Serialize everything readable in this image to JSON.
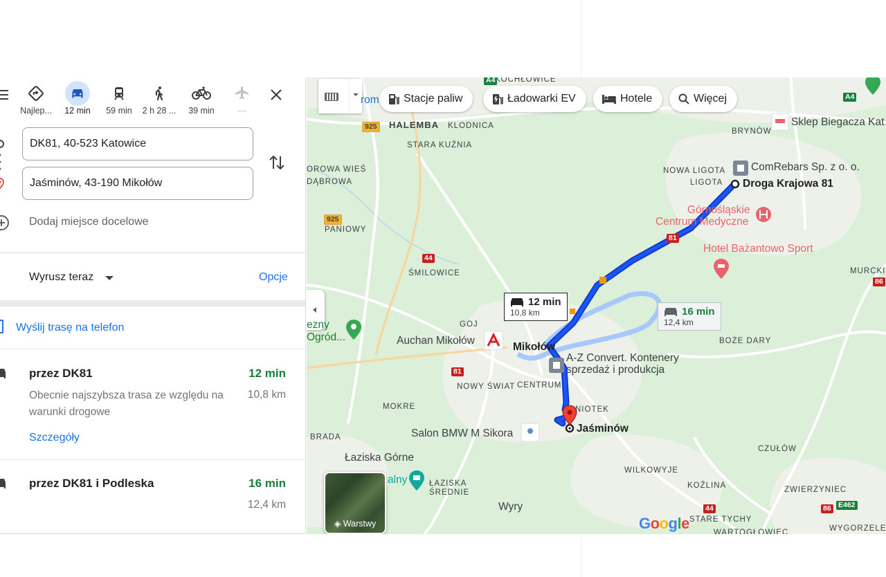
{
  "travel_modes": [
    {
      "id": "best",
      "label": "Najlep...",
      "icon": "directions-diamond-icon"
    },
    {
      "id": "car",
      "label": "12 min",
      "icon": "car-icon",
      "active": true
    },
    {
      "id": "transit",
      "label": "59 min",
      "icon": "train-icon"
    },
    {
      "id": "walk",
      "label": "2 h 28 ...",
      "icon": "walking-icon"
    },
    {
      "id": "bike",
      "label": "39 min",
      "icon": "bicycle-icon"
    },
    {
      "id": "flight",
      "label": "—",
      "icon": "airplane-icon"
    }
  ],
  "origin": {
    "value": "DK81, 40-523 Katowice"
  },
  "destination": {
    "value": "Jaśminów, 43-190 Mikołów"
  },
  "add_destination": "Dodaj miejsce docelowe",
  "depart": {
    "label": "Wyrusz teraz"
  },
  "options_label": "Opcje",
  "send_to_phone": "Wyślij trasę na telefon",
  "routes": [
    {
      "name": "przez DK81",
      "time": "12 min",
      "distance": "10,8 km",
      "description": "Obecnie najszybsza trasa ze względu na warunki drogowe",
      "details": "Szczegóły"
    },
    {
      "name": "przez DK81 i Podleska",
      "time": "16 min",
      "distance": "12,4 km"
    }
  ],
  "map": {
    "chips": [
      {
        "label": "Stacje paliw",
        "icon": "gas-station-icon"
      },
      {
        "label": "Ładowarki EV",
        "icon": "ev-charger-icon"
      },
      {
        "label": "Hotele",
        "icon": "hotel-bed-icon"
      },
      {
        "label": "Więcej",
        "icon": "search-icon"
      }
    ],
    "labels": {
      "kochlowice": "KOCHŁOWICE",
      "halemba": "HALEMBA",
      "klodnica": "KLODNICA",
      "stara_kuznia": "STARA KUŹNIA",
      "orowa_wies": "OROWA WIEŚ",
      "dabrowa": "DĄBROWA",
      "paniowy": "PANIOWY",
      "smilowice": "ŚMILOWICE",
      "goj": "GOJ",
      "nowa_ligota": "NOWA LIGOTA",
      "ligota": "LIGOTA",
      "brynow": "BRYNÓW",
      "murcki": "MURCKI",
      "boze_dary": "BOŻE DARY",
      "nowy_swiat": "NOWY ŚWIAT",
      "centrum": "CENTRUM",
      "mokre": "MOKRE",
      "brada": "BRADA",
      "niotek": "NIOTEK",
      "laziska_gorne": "Łaziska Górne",
      "laziska_srednie_1": "ŁAZISKA",
      "laziska_srednie_2": "ŚREDNIE",
      "wilkowyje": "WILKOWYJE",
      "kozlina": "KOŹLINA",
      "czulow": "CZUŁÓW",
      "zwierzyniec": "ZWIERZYNIEC",
      "wyry": "Wyry",
      "stare_tychy": "STARE TYCHY",
      "wartoglowiec": "WARTOGŁOWIEC",
      "wygorzele": "WYGORZELE",
      "mikolow": "Mikołów",
      "romi": "rom",
      "ogrod_1": "ezny",
      "ogrod_2": "Ogród...",
      "alny": "alny"
    },
    "pois": {
      "sklep": "Sklep Biegacza Kat",
      "comrebars": "ComRebars Sp. z o. o.",
      "droga": "Droga Krajowa 81",
      "gcm_1": "Górnośląskie",
      "gcm_2": "Centrum Medyczne",
      "hotel": "Hotel Bażantowo Sport",
      "auchan": "Auchan Mikołów",
      "az_1": "A-Z Convert. Kontenery",
      "az_2": "sprzedaż i produkcja",
      "bmw": "Salon BMW M Sikora",
      "jasminow": "Jaśminów"
    },
    "shields": {
      "a4_top": "A4",
      "a4_right": "A4",
      "r925_a": "925",
      "r925_b": "925",
      "r44": "44",
      "r81_left": "81",
      "r81_right": "81",
      "r86_a": "86",
      "r86_b": "86",
      "r44_b": "44",
      "e462": "E462"
    },
    "callout_main": {
      "time": "12 min",
      "distance": "10,8 km"
    },
    "callout_alt": {
      "time": "16 min",
      "distance": "12,4 km"
    },
    "layers_label": "Warstwy",
    "logo": "Google",
    "colors": {
      "route_primary": "#1a56f5",
      "route_alt": "#a8c7fa",
      "destination_pin": "#ea4335"
    }
  }
}
